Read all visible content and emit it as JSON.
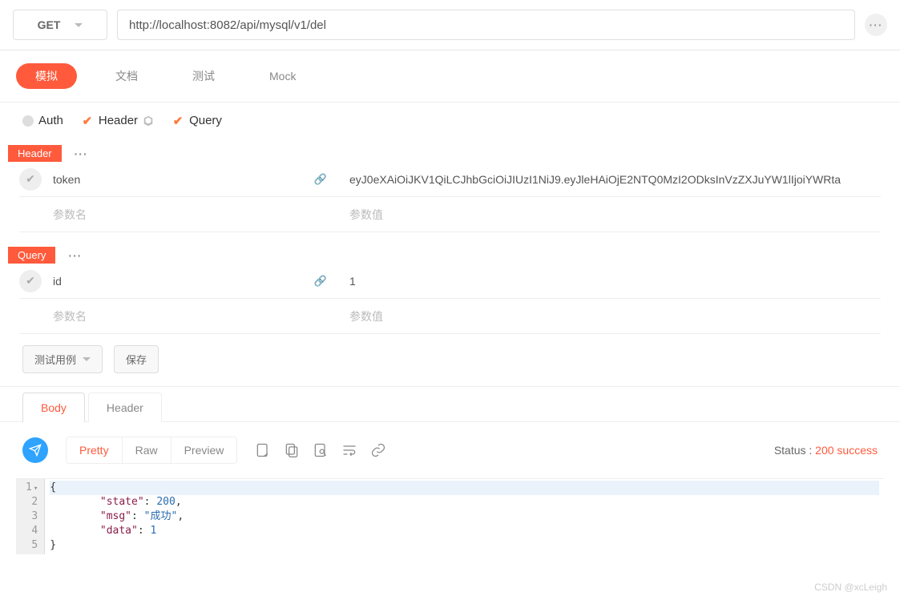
{
  "request": {
    "method": "GET",
    "url": "http://localhost:8082/api/mysql/v1/del"
  },
  "mainTabs": {
    "simulate": "模拟",
    "docs": "文档",
    "test": "测试",
    "mock": "Mock"
  },
  "subTabs": {
    "auth": "Auth",
    "header": "Header",
    "query": "Query"
  },
  "sections": {
    "header_label": "Header",
    "query_label": "Query"
  },
  "placeholders": {
    "param_name": "参数名",
    "param_value": "参数值"
  },
  "headerParams": [
    {
      "name": "token",
      "value": "eyJ0eXAiOiJKV1QiLCJhbGciOiJIUzI1NiJ9.eyJleHAiOjE2NTQ0MzI2ODksInVzZXJuYW1lIjoiYWRta"
    }
  ],
  "queryParams": [
    {
      "name": "id",
      "value": "1"
    }
  ],
  "actions": {
    "testcase": "测试用例",
    "save": "保存"
  },
  "responseTabs": {
    "body": "Body",
    "header": "Header"
  },
  "viewToggle": {
    "pretty": "Pretty",
    "raw": "Raw",
    "preview": "Preview"
  },
  "status": {
    "label": "Status : ",
    "value": "200 success"
  },
  "responseBody": {
    "line1": "{",
    "line2_key": "\"state\"",
    "line2_val": "200",
    "line3_key": "\"msg\"",
    "line3_val": "\"成功\"",
    "line4_key": "\"data\"",
    "line4_val": "1",
    "line5": "}"
  },
  "gutter": [
    "1",
    "2",
    "3",
    "4",
    "5"
  ],
  "watermark": "CSDN @xcLeigh"
}
